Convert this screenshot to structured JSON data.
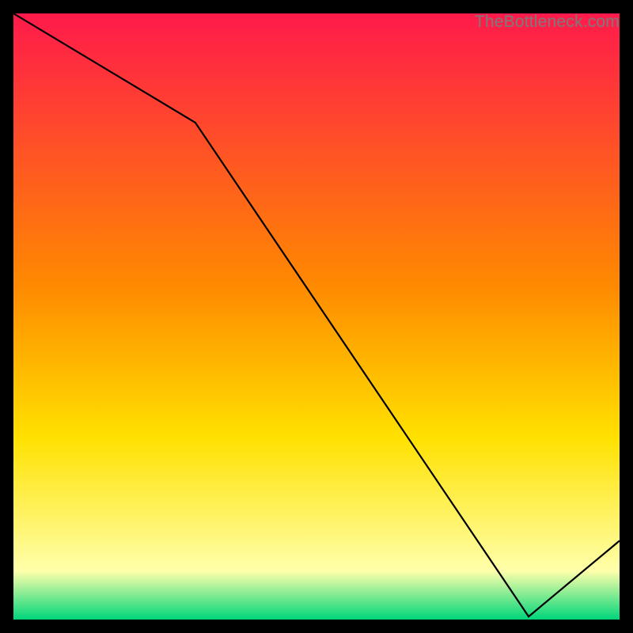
{
  "watermark": "TheBottleneck.com",
  "annotation": "",
  "colors": {
    "grad_top": "#ff1a4b",
    "grad_mid1": "#ff8a00",
    "grad_mid2": "#ffe100",
    "grad_pale": "#ffffaa",
    "grad_bottom": "#00d67a",
    "line": "#000000",
    "frame": "#000000"
  },
  "chart_data": {
    "type": "line",
    "title": "",
    "xlabel": "",
    "ylabel": "",
    "xlim": [
      0,
      100
    ],
    "ylim": [
      0,
      100
    ],
    "x": [
      0,
      30,
      85,
      100
    ],
    "values": [
      100,
      82,
      0.5,
      13
    ],
    "annotation_x": 82,
    "annotation_y": 1.5
  }
}
